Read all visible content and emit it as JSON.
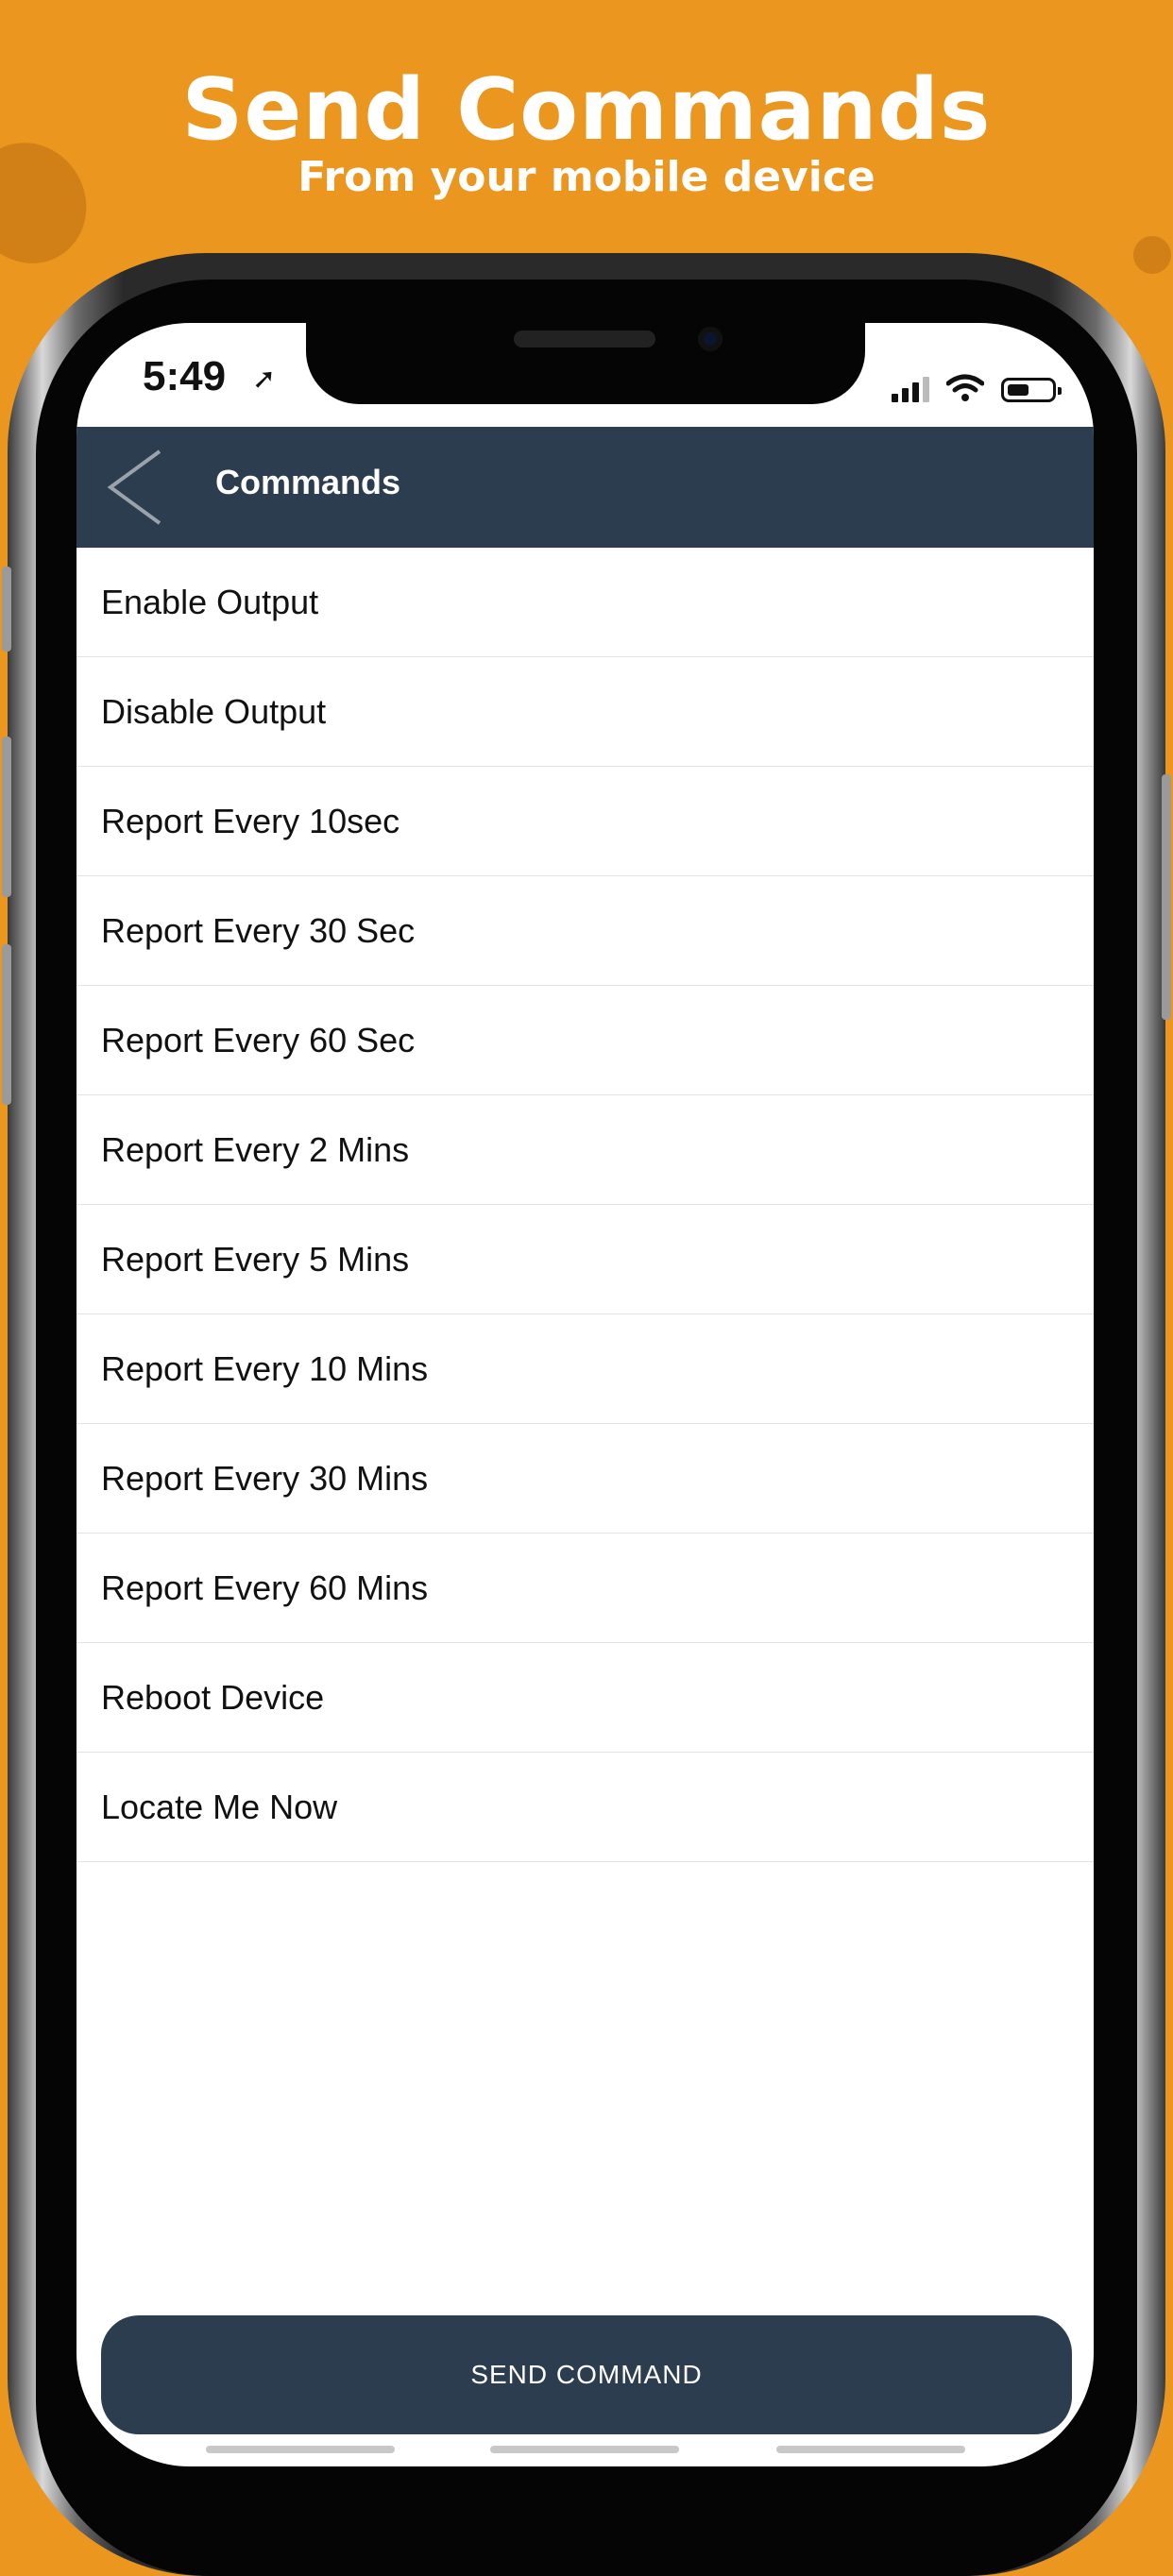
{
  "promo": {
    "title": "Send Commands",
    "subtitle": "From your mobile device"
  },
  "status_bar": {
    "time": "5:49"
  },
  "header": {
    "title": "Commands"
  },
  "commands": [
    "Enable Output",
    "Disable Output",
    "Report Every 10sec",
    "Report Every 30 Sec",
    "Report Every 60 Sec",
    "Report Every 2 Mins",
    "Report Every 5 Mins",
    "Report Every 10 Mins",
    "Report Every 30 Mins",
    "Report Every 60 Mins",
    "Reboot Device",
    "Locate Me Now"
  ],
  "send_button": {
    "label": "SEND COMMAND"
  },
  "icons": {
    "back": "chevron-left-icon",
    "location": "location-arrow-icon",
    "signal": "cellular-signal-icon",
    "wifi": "wifi-icon",
    "battery": "battery-icon"
  },
  "colors": {
    "background": "#ea961f",
    "header": "#2c3d4f",
    "button": "#2c3d4f"
  }
}
